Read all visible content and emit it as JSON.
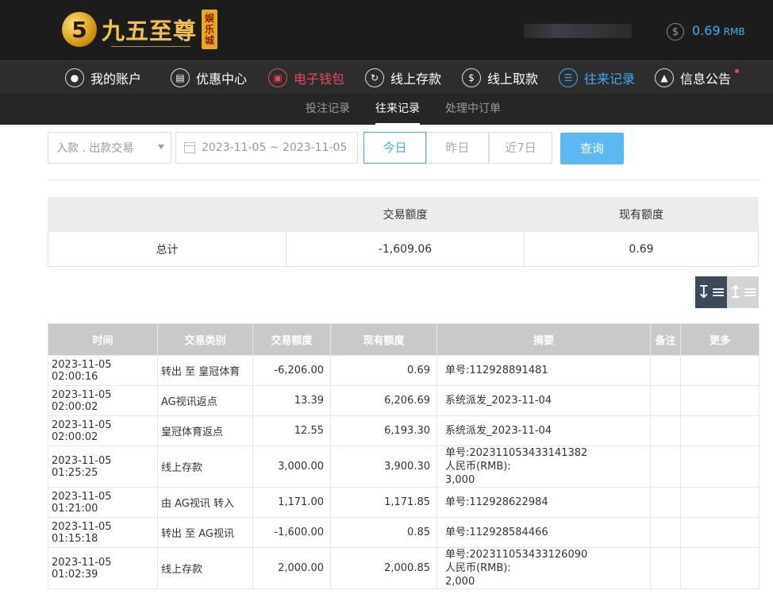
{
  "header": {
    "logo_glyph": "5",
    "logo_text": "九五至尊",
    "logo_badge": [
      "娱",
      "乐",
      "城"
    ],
    "balance_value": "0.69",
    "balance_unit": "RMB",
    "coin_symbol": "$"
  },
  "nav": [
    {
      "label": "我的账户",
      "icon": "user-icon"
    },
    {
      "label": "优惠中心",
      "icon": "gift-icon"
    },
    {
      "label": "电子钱包",
      "icon": "wallet-icon"
    },
    {
      "label": "线上存款",
      "icon": "deposit-icon"
    },
    {
      "label": "线上取款",
      "icon": "withdraw-icon"
    },
    {
      "label": "往来记录",
      "icon": "records-icon"
    },
    {
      "label": "信息公告",
      "icon": "bell-icon"
    }
  ],
  "subnav": [
    "投注记录",
    "往来记录",
    "处理中订单"
  ],
  "filters": {
    "type_select": "入款 . 出款交易",
    "date_range": "2023-11-05 ~ 2023-11-05",
    "periods": [
      "今日",
      "昨日",
      "近7日"
    ],
    "query": "查询"
  },
  "summary": {
    "headers": [
      "",
      "交易额度",
      "现有额度"
    ],
    "row": [
      "总计",
      "-1,609.06",
      "0.69"
    ]
  },
  "table": {
    "headers": [
      "时间",
      "交易类别",
      "交易额度",
      "现有额度",
      "摘要",
      "备注",
      "更多"
    ],
    "rows": [
      {
        "time": "2023-11-05 02:00:16",
        "type": "转出 至 皇冠体育",
        "amount": "-6,206.00",
        "balance": "0.69",
        "memo": [
          "单号:112928891481"
        ]
      },
      {
        "time": "2023-11-05 02:00:02",
        "type": "AG视讯返点",
        "amount": "13.39",
        "balance": "6,206.69",
        "memo": [
          "系统派发_2023-11-04"
        ]
      },
      {
        "time": "2023-11-05 02:00:02",
        "type": "皇冠体育返点",
        "amount": "12.55",
        "balance": "6,193.30",
        "memo": [
          "系统派发_2023-11-04"
        ]
      },
      {
        "time": "2023-11-05 01:25:25",
        "type": "线上存款",
        "amount": "3,000.00",
        "balance": "3,900.30",
        "memo": [
          "单号:202311053433141382",
          "人民币(RMB):",
          "3,000"
        ]
      },
      {
        "time": "2023-11-05 01:21:00",
        "type": "由 AG视讯 转入",
        "amount": "1,171.00",
        "balance": "1,171.85",
        "memo": [
          "单号:112928622984"
        ]
      },
      {
        "time": "2023-11-05 01:15:18",
        "type": "转出 至 AG视讯",
        "amount": "-1,600.00",
        "balance": "0.85",
        "memo": [
          "单号:112928584466"
        ]
      },
      {
        "time": "2023-11-05 01:02:39",
        "type": "线上存款",
        "amount": "2,000.00",
        "balance": "2,000.85",
        "memo": [
          "单号:202311053433126090",
          "人民币(RMB):",
          "2,000"
        ]
      }
    ]
  },
  "colors": {
    "accent": "#3fa9f5",
    "active_red": "#e9465c",
    "header_bg": "#1c1c1c"
  }
}
